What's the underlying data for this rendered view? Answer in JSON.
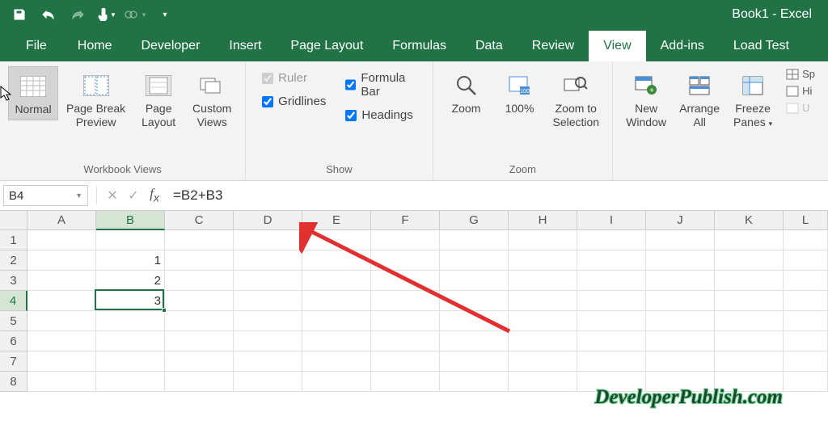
{
  "title": "Book1 - Excel",
  "tabs": {
    "file": "File",
    "items": [
      "Home",
      "Developer",
      "Insert",
      "Page Layout",
      "Formulas",
      "Data",
      "Review",
      "View",
      "Add-ins",
      "Load Test"
    ],
    "active": "View"
  },
  "ribbon": {
    "workbook_views": {
      "label": "Workbook Views",
      "normal": "Normal",
      "page_break": "Page Break\nPreview",
      "page_layout": "Page\nLayout",
      "custom_views": "Custom\nViews"
    },
    "show": {
      "label": "Show",
      "ruler": "Ruler",
      "formula_bar": "Formula Bar",
      "gridlines": "Gridlines",
      "headings": "Headings"
    },
    "zoom": {
      "label": "Zoom",
      "zoom": "Zoom",
      "hundred": "100%",
      "to_selection": "Zoom to\nSelection"
    },
    "window": {
      "new_window": "New\nWindow",
      "arrange_all": "Arrange\nAll",
      "freeze": "Freeze\nPanes"
    },
    "right": {
      "split": "Sp",
      "hide": "Hi",
      "unhide": "U"
    }
  },
  "namebox": "B4",
  "formula": "=B2+B3",
  "columns": [
    "A",
    "B",
    "C",
    "D",
    "E",
    "F",
    "G",
    "H",
    "I",
    "J",
    "K",
    "L"
  ],
  "rows": [
    "1",
    "2",
    "3",
    "4",
    "5",
    "6",
    "7",
    "8"
  ],
  "cells": {
    "B2": "1",
    "B3": "2",
    "B4": "3"
  },
  "active_col": "B",
  "active_row": "4",
  "watermark": "DeveloperPublish.com"
}
